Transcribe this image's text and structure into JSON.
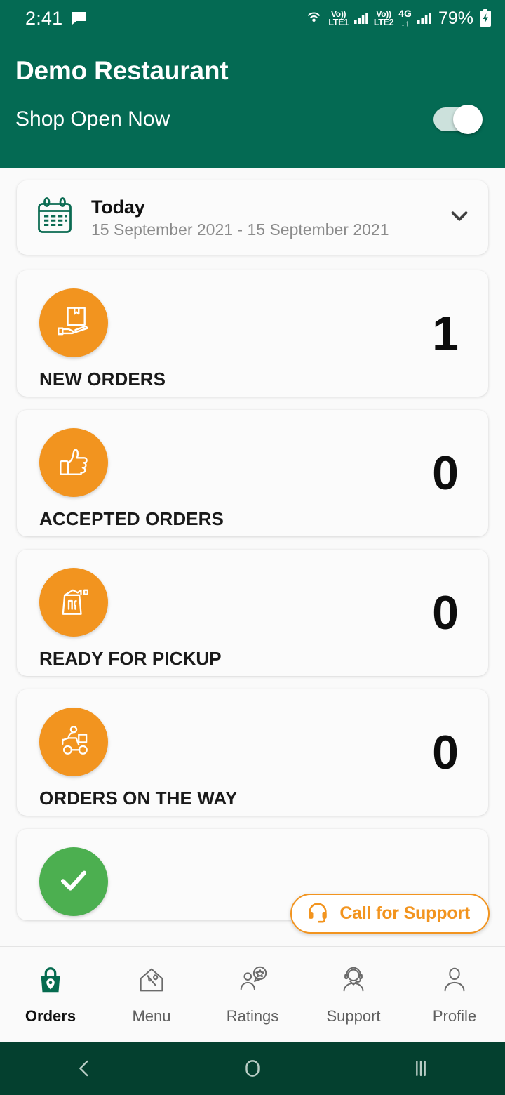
{
  "status_bar": {
    "time": "2:41",
    "notification_icon": "message-icon",
    "hotspot_icon": "hotspot-icon",
    "sim1_label_top": "Vo))",
    "sim1_label_bottom": "LTE1",
    "sim2_label_top": "Vo))",
    "sim2_label_bottom": "LTE2",
    "network_type": "4G",
    "data_arrows": "↓↑",
    "battery_percent": "79%",
    "battery_icon": "battery-charging-icon"
  },
  "header": {
    "title": "Demo Restaurant",
    "shop_status_label": "Shop Open Now",
    "shop_toggle_on": true,
    "background_color": "#046a53"
  },
  "date_selector": {
    "icon": "calendar-icon",
    "title": "Today",
    "range": "15 September 2021 - 15 September 2021",
    "chevron_icon": "chevron-down-icon"
  },
  "stats": [
    {
      "icon": "hand-holding-package-icon",
      "label": "NEW ORDERS",
      "count": "1",
      "color": "#f2941f"
    },
    {
      "icon": "thumbs-up-icon",
      "label": "ACCEPTED ORDERS",
      "count": "0",
      "color": "#f2941f"
    },
    {
      "icon": "takeaway-bag-icon",
      "label": "READY FOR PICKUP",
      "count": "0",
      "color": "#f2941f"
    },
    {
      "icon": "delivery-scooter-icon",
      "label": "ORDERS ON THE WAY",
      "count": "0",
      "color": "#f2941f"
    },
    {
      "icon": "check-circle-icon",
      "label": "",
      "count": "",
      "color": "#4caf50"
    }
  ],
  "support_button": {
    "label": "Call for Support",
    "icon": "headset-icon",
    "color": "#f2941f"
  },
  "bottom_nav": {
    "items": [
      {
        "icon": "shopping-bag-pin-icon",
        "label": "Orders",
        "active": true
      },
      {
        "icon": "restaurant-house-icon",
        "label": "Menu",
        "active": false
      },
      {
        "icon": "person-star-icon",
        "label": "Ratings",
        "active": false
      },
      {
        "icon": "headset-person-icon",
        "label": "Support",
        "active": false
      },
      {
        "icon": "person-icon",
        "label": "Profile",
        "active": false
      }
    ],
    "active_color": "#056b4f"
  },
  "android_nav": {
    "back_icon": "back-chevron-icon",
    "home_icon": "home-circle-icon",
    "recents_icon": "recents-bars-icon",
    "background_color": "#04402f"
  }
}
